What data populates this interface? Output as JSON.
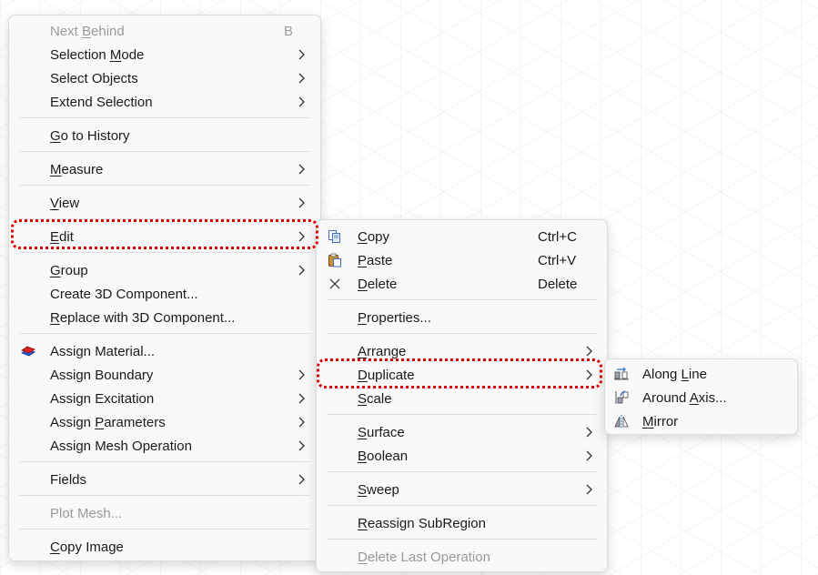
{
  "main_menu": {
    "items": [
      {
        "pre": "Next ",
        "ul": "B",
        "post": "ehind",
        "shortcut": "B",
        "disabled": true
      },
      {
        "pre": "Selection ",
        "ul": "M",
        "post": "ode",
        "submenu": true
      },
      {
        "pre": "Select Objects",
        "ul": "",
        "post": "",
        "submenu": true
      },
      {
        "pre": "Extend Selection",
        "ul": "",
        "post": "",
        "submenu": true
      },
      {
        "pre": "",
        "ul": "G",
        "post": "o to History"
      },
      {
        "pre": "",
        "ul": "M",
        "post": "easure",
        "submenu": true
      },
      {
        "pre": "",
        "ul": "V",
        "post": "iew",
        "submenu": true
      },
      {
        "pre": "",
        "ul": "E",
        "post": "dit",
        "submenu": true
      },
      {
        "pre": "",
        "ul": "G",
        "post": "roup",
        "submenu": true
      },
      {
        "pre": "Create 3D Component...",
        "ul": "",
        "post": ""
      },
      {
        "pre": "",
        "ul": "R",
        "post": "eplace with 3D Component..."
      },
      {
        "pre": "Assign Material...",
        "ul": "",
        "post": "",
        "icon": "material-icon"
      },
      {
        "pre": "Assign Boundary",
        "ul": "",
        "post": "",
        "submenu": true
      },
      {
        "pre": "Assign Excitation",
        "ul": "",
        "post": "",
        "submenu": true
      },
      {
        "pre": "Assign ",
        "ul": "P",
        "post": "arameters",
        "submenu": true
      },
      {
        "pre": "Assign Mesh Operation",
        "ul": "",
        "post": "",
        "submenu": true
      },
      {
        "pre": "Fields",
        "ul": "",
        "post": "",
        "submenu": true
      },
      {
        "pre": "Plot Mesh...",
        "ul": "",
        "post": "",
        "disabled": true
      },
      {
        "pre": "",
        "ul": "C",
        "post": "opy Image"
      }
    ]
  },
  "edit_menu": {
    "items": [
      {
        "pre": "",
        "ul": "C",
        "post": "opy",
        "shortcut": "Ctrl+C",
        "icon": "copy-icon"
      },
      {
        "pre": "",
        "ul": "P",
        "post": "aste",
        "shortcut": "Ctrl+V",
        "icon": "paste-icon"
      },
      {
        "pre": "",
        "ul": "D",
        "post": "elete",
        "shortcut": "Delete",
        "icon": "delete-icon"
      },
      {
        "pre": "",
        "ul": "P",
        "post": "roperties..."
      },
      {
        "pre": "",
        "ul": "A",
        "post": "rrange",
        "submenu": true
      },
      {
        "pre": "",
        "ul": "D",
        "post": "uplicate",
        "submenu": true
      },
      {
        "pre": "",
        "ul": "S",
        "post": "cale"
      },
      {
        "pre": "",
        "ul": "S",
        "post": "urface",
        "submenu": true
      },
      {
        "pre": "",
        "ul": "B",
        "post": "oolean",
        "submenu": true
      },
      {
        "pre": "",
        "ul": "S",
        "post": "weep",
        "submenu": true
      },
      {
        "pre": "",
        "ul": "R",
        "post": "eassign SubRegion"
      },
      {
        "pre": "",
        "ul": "D",
        "post": "elete Last Operation",
        "disabled": true
      }
    ]
  },
  "duplicate_menu": {
    "items": [
      {
        "pre": "Along ",
        "ul": "L",
        "post": "ine",
        "icon": "along-line-icon"
      },
      {
        "pre": "Around ",
        "ul": "A",
        "post": "xis...",
        "icon": "around-axis-icon"
      },
      {
        "pre": "",
        "ul": "M",
        "post": "irror",
        "icon": "mirror-icon"
      }
    ]
  },
  "colors": {
    "highlight_outline": "#e00000",
    "menu_bg": "#f9f9f9",
    "disabled_text": "#9a9a9a"
  }
}
